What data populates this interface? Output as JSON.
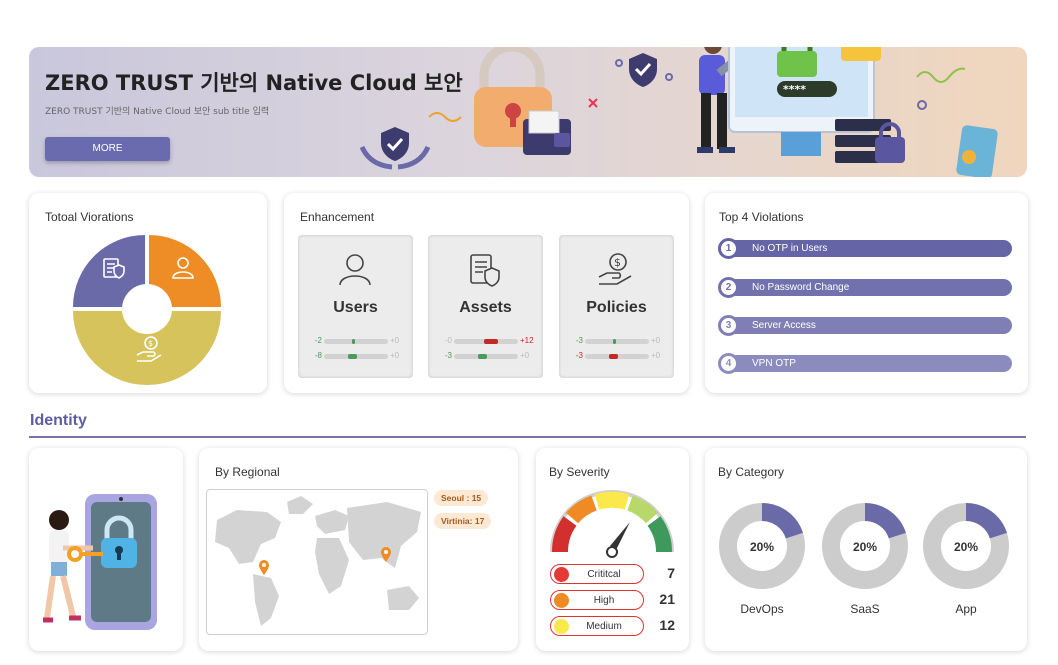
{
  "banner": {
    "title": "ZERO TRUST 기반의 Native Cloud 보안",
    "subtitle": "ZERO TRUST 기반의 Native Cloud 보안 sub title 입력",
    "button_label": "MORE",
    "password_mask": "****"
  },
  "total_violations": {
    "title": "Totoal Viorations",
    "segments": [
      {
        "icon": "document-shield-icon",
        "color": "#6b6aa9"
      },
      {
        "icon": "user-icon",
        "color": "#ee8d26"
      },
      {
        "icon": "hand-coin-icon",
        "color": "#d6c35c"
      }
    ]
  },
  "enhancement": {
    "title": "Enhancement",
    "items": [
      {
        "name": "Users",
        "icon": "user-icon",
        "rows": [
          {
            "left": "-2",
            "right": "+0",
            "left_color": "#4a9a5c",
            "right_color": "#bbbbbb",
            "fill_color": "#4a9a5c",
            "level": "low"
          },
          {
            "left": "-8",
            "right": "+0",
            "left_color": "#4a9a5c",
            "right_color": "#bbbbbb",
            "fill_color": "#4a9a5c",
            "level": "mid"
          }
        ]
      },
      {
        "name": "Assets",
        "icon": "document-shield-icon",
        "rows": [
          {
            "left": "-0",
            "right": "+12",
            "left_color": "#bbbbbb",
            "right_color": "#c62828",
            "fill_color": "#c62828",
            "level": "high"
          },
          {
            "left": "-3",
            "right": "+0",
            "left_color": "#4a9a5c",
            "right_color": "#bbbbbb",
            "fill_color": "#4a9a5c",
            "level": "mid"
          }
        ]
      },
      {
        "name": "Policies",
        "icon": "hand-coin-icon",
        "rows": [
          {
            "left": "-3",
            "right": "+0",
            "left_color": "#4a9a5c",
            "right_color": "#bbbbbb",
            "fill_color": "#4a9a5c",
            "level": "low"
          },
          {
            "left": "-3",
            "right": "+0",
            "left_color": "#c62828",
            "right_color": "#bbbbbb",
            "fill_color": "#c62828",
            "level": "mid"
          }
        ]
      }
    ]
  },
  "top_violations": {
    "title": "Top 4 Violations",
    "items": [
      {
        "rank": "1",
        "label": "No OTP in Users",
        "color": "#6464a6"
      },
      {
        "rank": "2",
        "label": "No Password Change",
        "color": "#7171ad"
      },
      {
        "rank": "3",
        "label": "Server Access",
        "color": "#7f7fb5"
      },
      {
        "rank": "4",
        "label": "VPN OTP",
        "color": "#8b8bbd"
      }
    ]
  },
  "identity": {
    "heading": "Identity",
    "regional": {
      "title": "By Regional",
      "locations": [
        {
          "label": "Seoul : 15"
        },
        {
          "label": "Virtinia: 17"
        }
      ]
    },
    "severity": {
      "title": "By Severity",
      "levels": [
        {
          "name": "Crititcal",
          "value": "7",
          "color": "#e53935"
        },
        {
          "name": "High",
          "value": "21",
          "color": "#f08a24"
        },
        {
          "name": "Medium",
          "value": "12",
          "color": "#fbe94b"
        }
      ]
    },
    "category": {
      "title": "By Category",
      "items": [
        {
          "name": "DevOps",
          "pct_label": "20%",
          "fraction": 0.2
        },
        {
          "name": "SaaS",
          "pct_label": "20%",
          "fraction": 0.2
        },
        {
          "name": "App",
          "pct_label": "20%",
          "fraction": 0.2
        }
      ],
      "accent": "#6b6aa9",
      "track": "#cccccc"
    }
  }
}
